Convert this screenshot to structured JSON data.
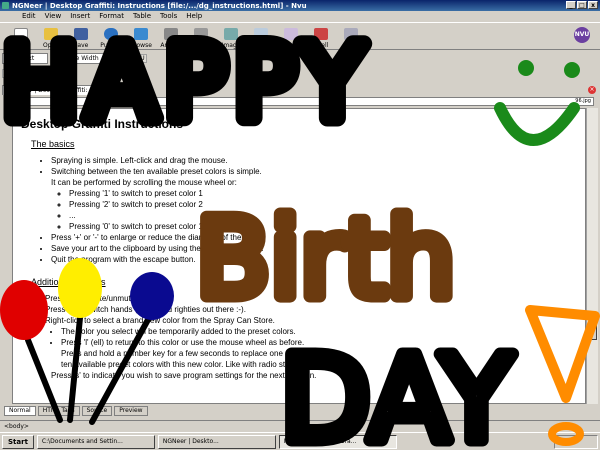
{
  "window": {
    "title": "NGNeer | Desktop Graffiti: Instructions [file:/.../dg_instructions.html] - Nvu",
    "minimize": "_",
    "maximize": "□",
    "close": "x"
  },
  "menu": [
    "Edit",
    "View",
    "Insert",
    "Format",
    "Table",
    "Tools",
    "Help"
  ],
  "toolbar": [
    "New",
    "Open",
    "Save",
    "Publish",
    "Browse",
    "Anchor",
    "Link",
    "Image",
    "Table",
    "Form",
    "Spell",
    "Print"
  ],
  "nvu_logo": "NVU",
  "format": {
    "style": "Body Text",
    "width": "Variable Width"
  },
  "doc_tab": "NGNeer | Desktop Graffiti: Instructions",
  "url_tail": "96.jpg",
  "doc": {
    "title": "Desktop Graffiti Instructions",
    "basics_heading": "The basics",
    "basics": [
      "Spraying is simple. Left-click and drag the mouse.",
      "Switching between the ten available preset colors is simple.",
      "It can be performed by scrolling the mouse wheel or:"
    ],
    "preset_items": [
      "Pressing '1' to switch to preset color 1",
      "Pressing '2' to switch to preset color 2",
      "...",
      "Pressing '0' to switch to preset color 10"
    ],
    "more_basics": [
      "Press '+' or '-' to enlarge or reduce the diameter of the spray.",
      "Save your art to the clipboard by using the Print Screen key.",
      "Quit the program with the escape button."
    ],
    "additional_heading": "Additional features",
    "additional": [
      "Press 'm' to mute/unmute sound.",
      "Press 'h' to switch hands (for all you righties out there :-).",
      "Right-click to select a brand new color from the Spray Can Store."
    ],
    "color_items": [
      "The color you select will be temporarily added to the preset colors.",
      "Press 'l' (ell) to return to this color or use the mouse wheel as before.",
      "Press and hold a number key for a few seconds to replace one of the",
      "ten available preset colors with this new color. Like with radio stations."
    ],
    "final": "Press 's' to indicate you wish to save program settings for the next session."
  },
  "mode_tabs": [
    "Normal",
    "HTML Tags",
    "Source",
    "Preview"
  ],
  "status": "<body>",
  "taskbar": {
    "start": "Start",
    "items": [
      "C:\\Documents and Settin...",
      "NGNeer | Deskto...",
      "NGNeer | Desktop Gra..."
    ]
  },
  "graffiti": {
    "happy": "HAPPY",
    "birth": "Birth",
    "day": "DAY",
    "smiley": ":)",
    "exclaim": "!"
  },
  "colors": {
    "ink": "#000000",
    "brown": "#6b3a0f",
    "green": "#1a8a1a",
    "orange": "#ff8c00",
    "red": "#e00000",
    "yellow": "#ffee00",
    "blue": "#0a0a90"
  }
}
